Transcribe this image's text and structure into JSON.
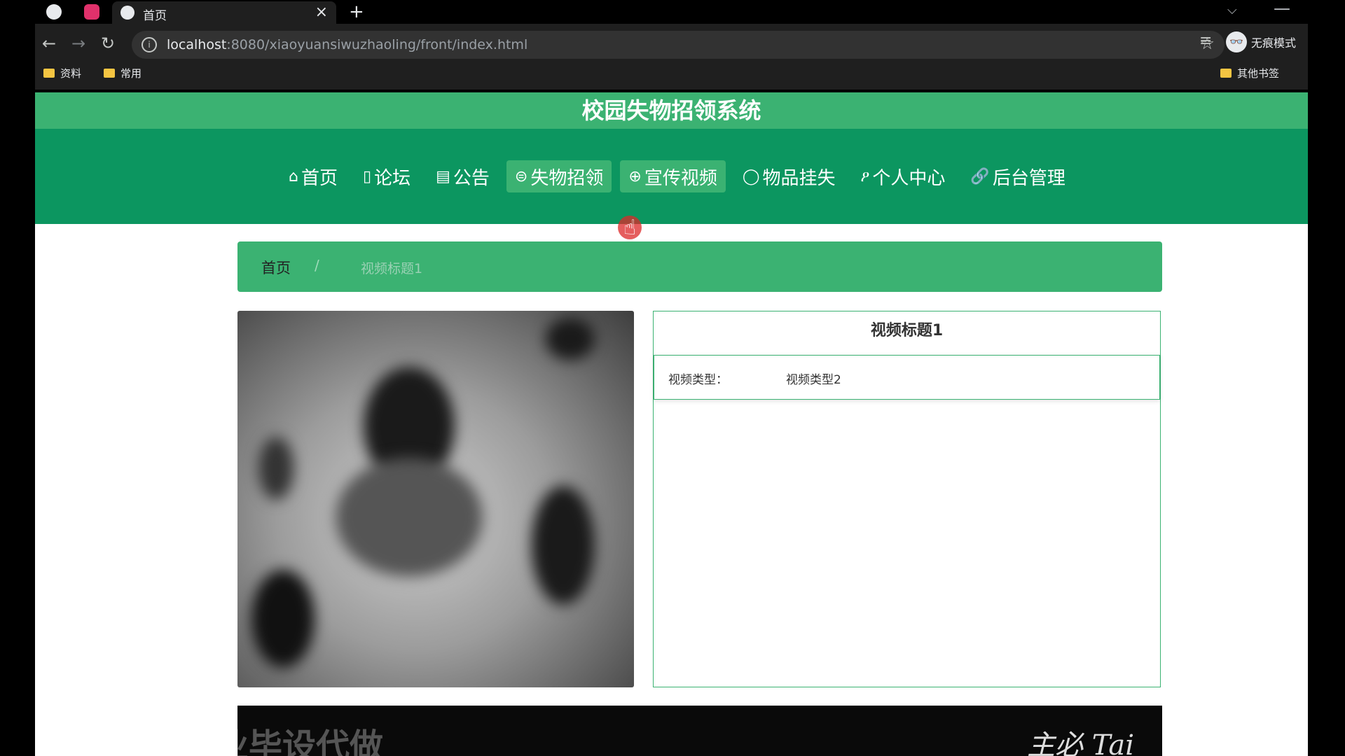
{
  "browser": {
    "tab_title": "首页",
    "tab_close": "×",
    "new_tab": "+",
    "url_host": "localhost",
    "url_path": ":8080/xiaoyuansiwuzhaoling/front/index.html",
    "profile_label": "无痕模式",
    "bookmarks": [
      "资料",
      "常用"
    ],
    "other_bookmarks": "其他书签",
    "icons": {
      "back": "←",
      "forward": "→",
      "reload": "↻",
      "star": "☆",
      "tab_dropdown": "⌵",
      "minimize": "—",
      "media": "≡",
      "info": "i",
      "incognito": "👓"
    }
  },
  "site": {
    "title": "校园失物招领系统",
    "nav": [
      {
        "icon": "⌂",
        "label": "首页"
      },
      {
        "icon": "▯",
        "label": "论坛"
      },
      {
        "icon": "▤",
        "label": "公告"
      },
      {
        "icon": "⊜",
        "label": "失物招领"
      },
      {
        "icon": "⊕",
        "label": "宣传视频"
      },
      {
        "icon": "◯",
        "label": "物品挂失"
      },
      {
        "icon": "ዖ",
        "label": "个人中心"
      },
      {
        "icon": "🔗",
        "label": "后台管理"
      }
    ]
  },
  "breadcrumb": {
    "home": "首页",
    "separator": "/",
    "current": "视频标题1"
  },
  "detail": {
    "title": "视频标题1",
    "type_label": "视频类型：",
    "type_value": "视频类型2"
  },
  "banner": {
    "left_text": "专业毕设代做",
    "right_text": "主必 Tai"
  }
}
